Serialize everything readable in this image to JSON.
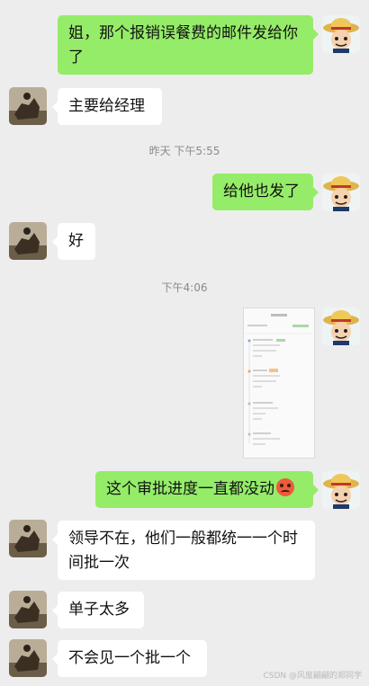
{
  "messages": [
    {
      "sender": "me",
      "text": "姐，那个报销误餐费的邮件发给你了"
    },
    {
      "sender": "other",
      "text": "主要给经理"
    },
    {
      "sender": "me",
      "text": "给他也发了"
    },
    {
      "sender": "other",
      "text": "好"
    },
    {
      "sender": "me",
      "text": "这个审批进度一直都没动",
      "emoji": "angry-face"
    },
    {
      "sender": "other",
      "text": "领导不在，他们一般都统一一个时间批一次"
    },
    {
      "sender": "other",
      "text": "单子太多"
    },
    {
      "sender": "other",
      "text": "不会见一个批一个"
    }
  ],
  "timestamps": [
    "昨天 下午5:55",
    "下午4:06"
  ],
  "watermark": "CSDN @风度翩翩的郑同学"
}
